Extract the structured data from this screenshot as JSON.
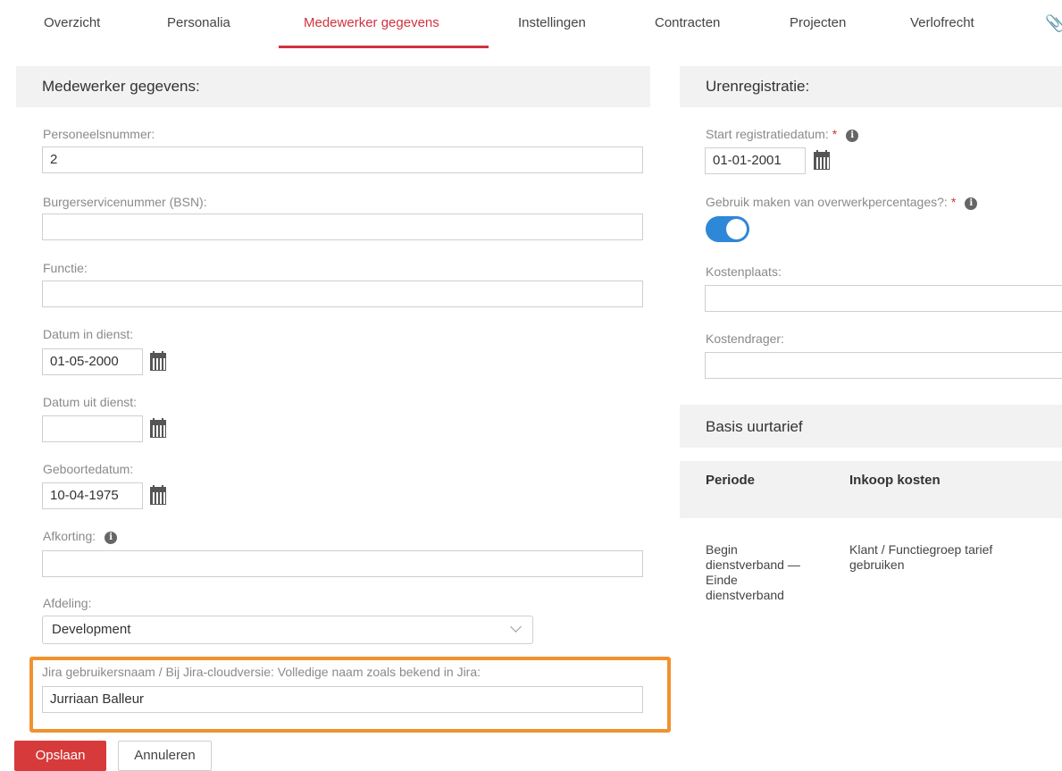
{
  "tabs": [
    {
      "label": "Overzicht"
    },
    {
      "label": "Personalia"
    },
    {
      "label": "Medewerker gegevens",
      "active": true
    },
    {
      "label": "Instellingen"
    },
    {
      "label": "Contracten"
    },
    {
      "label": "Projecten"
    },
    {
      "label": "Verlofrecht"
    }
  ],
  "left": {
    "header": "Medewerker gegevens:",
    "personeelsnummer": {
      "label": "Personeelsnummer:",
      "value": "2"
    },
    "bsn": {
      "label": "Burgerservicenummer (BSN):",
      "value": ""
    },
    "functie": {
      "label": "Functie:",
      "value": ""
    },
    "datum_in_dienst": {
      "label": "Datum in dienst:",
      "value": "01-05-2000"
    },
    "datum_uit_dienst": {
      "label": "Datum uit dienst:",
      "value": ""
    },
    "geboortedatum": {
      "label": "Geboortedatum:",
      "value": "10-04-1975"
    },
    "afkorting": {
      "label": "Afkorting:",
      "value": ""
    },
    "afdeling": {
      "label": "Afdeling:",
      "value": "Development"
    },
    "jira": {
      "label": "Jira gebruikersnaam / Bij Jira-cloudversie: Volledige naam zoals bekend in Jira:",
      "value": "Jurriaan Balleur"
    }
  },
  "right": {
    "header": "Urenregistratie:",
    "start_registratiedatum": {
      "label": "Start registratiedatum:",
      "required": "*",
      "value": "01-01-2001"
    },
    "overwerk": {
      "label": "Gebruik maken van overwerkpercentages?:",
      "required": "*",
      "enabled": true
    },
    "kostenplaats": {
      "label": "Kostenplaats:",
      "value": ""
    },
    "kostendrager": {
      "label": "Kostendrager:",
      "value": ""
    },
    "basis_header": "Basis uurtarief",
    "table": {
      "columns": [
        "Periode",
        "Inkoop kosten"
      ],
      "rows": [
        {
          "periode_lines": [
            "Begin",
            "dienstverband —",
            "Einde",
            "dienstverband"
          ],
          "inkoop_lines": [
            "Klant / Functiegroep tarief",
            "gebruiken"
          ]
        }
      ]
    }
  },
  "buttons": {
    "save": "Opslaan",
    "cancel": "Annuleren"
  },
  "colors": {
    "accent": "#d0323e",
    "toggle": "#2f87d8",
    "highlight": "#f0922e"
  }
}
